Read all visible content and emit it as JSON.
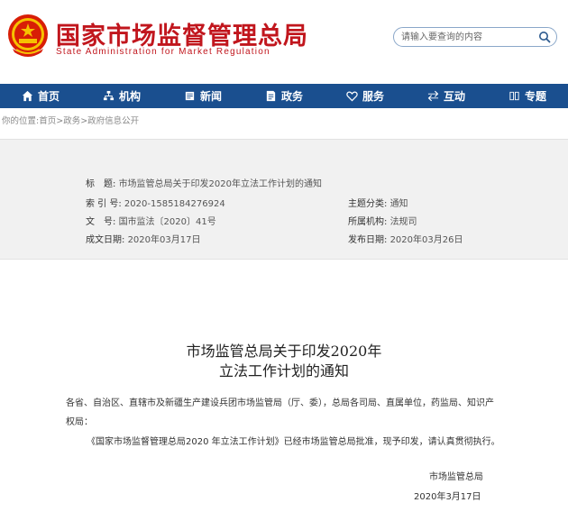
{
  "header": {
    "title_cn": "国家市场监督管理总局",
    "title_en": "State Administration for Market Regulation",
    "search_placeholder": "请输入要查询的内容",
    "colors": {
      "brand_red": "#c1161d",
      "nav_blue": "#1a4f8f"
    }
  },
  "nav": {
    "items": [
      {
        "label": "首页",
        "icon": "home-icon"
      },
      {
        "label": "机构",
        "icon": "org-icon"
      },
      {
        "label": "新闻",
        "icon": "news-icon"
      },
      {
        "label": "政务",
        "icon": "affairs-icon"
      },
      {
        "label": "服务",
        "icon": "heart-icon"
      },
      {
        "label": "互动",
        "icon": "exchange-icon"
      },
      {
        "label": "专题",
        "icon": "topic-icon"
      }
    ]
  },
  "breadcrumb": {
    "prefix": "你的位置:",
    "items": [
      "首页",
      "政务",
      "政府信息公开"
    ],
    "separator": ">"
  },
  "meta": {
    "title_label": "标　题:",
    "title_value": "市场监管总局关于印发2020年立法工作计划的通知",
    "index_label": "索 引 号:",
    "index_value": "2020-1585184276924",
    "category_label": "主题分类:",
    "category_value": "通知",
    "doc_no_label": "文　号:",
    "doc_no_value": "国市监法〔2020〕41号",
    "org_label": "所属机构:",
    "org_value": "法规司",
    "created_label": "成文日期:",
    "created_value": "2020年03月17日",
    "published_label": "发布日期:",
    "published_value": "2020年03月26日"
  },
  "article": {
    "title_line1": "市场监管总局关于印发2020年",
    "title_line2": "立法工作计划的通知",
    "para1_line1": "各省、自治区、直辖市及新疆生产建设兵团市场监管局（厅、委），总局各司局、直属单位，药监局、知识产",
    "para1_line2": "权局：",
    "para2": "《国家市场监督管理总局2020 年立法工作计划》已经市场监管总局批准，现予印发，请认真贯彻执行。",
    "signature": "市场监管总局",
    "date": "2020年3月17日"
  }
}
